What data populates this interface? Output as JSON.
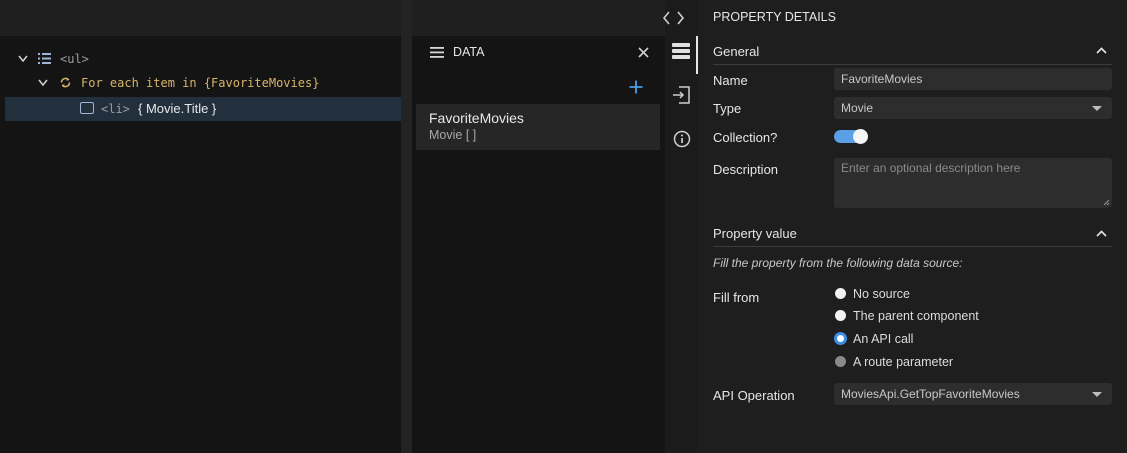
{
  "tree": {
    "row1": {
      "tag": "<ul>"
    },
    "row2": {
      "text": "For each item in {FavoriteMovies}"
    },
    "row3": {
      "tag": "<li>",
      "content": "{ Movie.Title }"
    }
  },
  "data_panel": {
    "title": "DATA",
    "item": {
      "name": "FavoriteMovies",
      "type": "Movie [ ]"
    }
  },
  "details": {
    "title": "PROPERTY DETAILS",
    "general": {
      "heading": "General",
      "name_label": "Name",
      "name_value": "FavoriteMovies",
      "type_label": "Type",
      "type_value": "Movie",
      "collection_label": "Collection?",
      "collection_on": true,
      "description_label": "Description",
      "description_placeholder": "Enter an optional description here"
    },
    "property_value": {
      "heading": "Property value",
      "hint": "Fill the property from the following data source:",
      "fill_from_label": "Fill from",
      "options": [
        "No source",
        "The parent component",
        "An API call",
        "A route parameter"
      ],
      "selected": "An API call",
      "api_label": "API Operation",
      "api_value": "MoviesApi.GetTopFavoriteMovies"
    }
  },
  "colors": {
    "accent": "#3b8ee8",
    "keyword": "#d7b46a",
    "tag": "#9a9a9a",
    "toggle": "#5aa0e6"
  }
}
